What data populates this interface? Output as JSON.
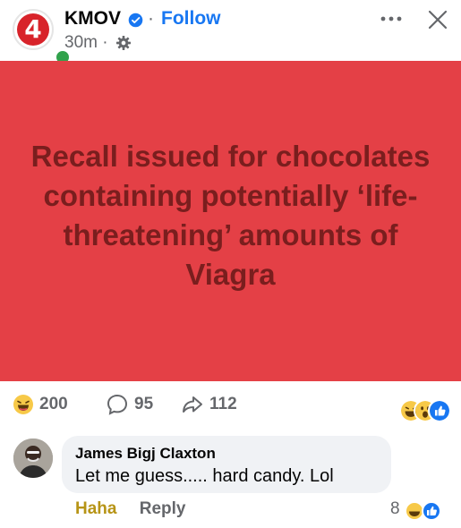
{
  "post": {
    "page_name": "KMOV",
    "separator": "·",
    "follow_label": "Follow",
    "time": "30m ·",
    "avatar_glyph": "4"
  },
  "banner": {
    "headline": "Recall issued for chocolates containing potentially ‘life-threatening’ amounts of Viagra",
    "background": "#e44046",
    "text_color": "#7a1e1e"
  },
  "stats": {
    "reactions": "200",
    "comments": "95",
    "shares": "112"
  },
  "comment": {
    "author": "James Bigj Claxton",
    "text": "Let me guess..... hard candy. Lol",
    "reaction_label": "Haha",
    "reply_label": "Reply",
    "reaction_count": "8"
  },
  "colors": {
    "accent": "#1877f2",
    "haha": "#b79416",
    "muted": "#65676b"
  },
  "icons": [
    "verified-badge-icon",
    "gear-icon",
    "more-icon",
    "close-icon",
    "haha-icon",
    "wow-icon",
    "like-icon",
    "comment-icon",
    "share-icon"
  ]
}
